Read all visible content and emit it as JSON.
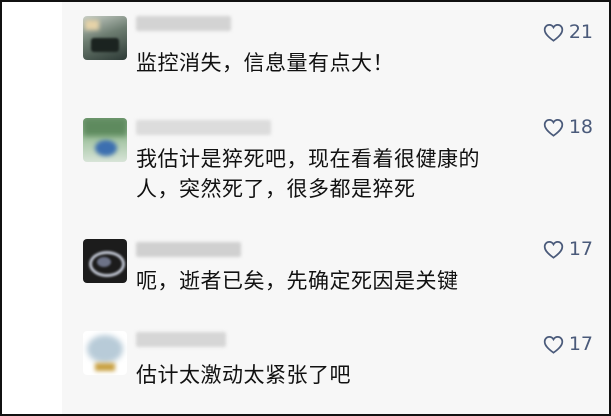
{
  "comments": [
    {
      "likes": "21",
      "text": "监控消失，信息量有点大！"
    },
    {
      "likes": "18",
      "text": "我估计是猝死吧，现在看着很健康的人，突然死了，很多都是猝死"
    },
    {
      "likes": "17",
      "text": "呃，逝者已矣，先确定死因是关键"
    },
    {
      "likes": "17",
      "text": "估计太激动太紧张了吧"
    }
  ],
  "colors": {
    "background": "#f7f7f7",
    "like_color": "#4a5a7a",
    "text_color": "#111111"
  },
  "icons": {
    "like": "heart-outline-icon"
  }
}
